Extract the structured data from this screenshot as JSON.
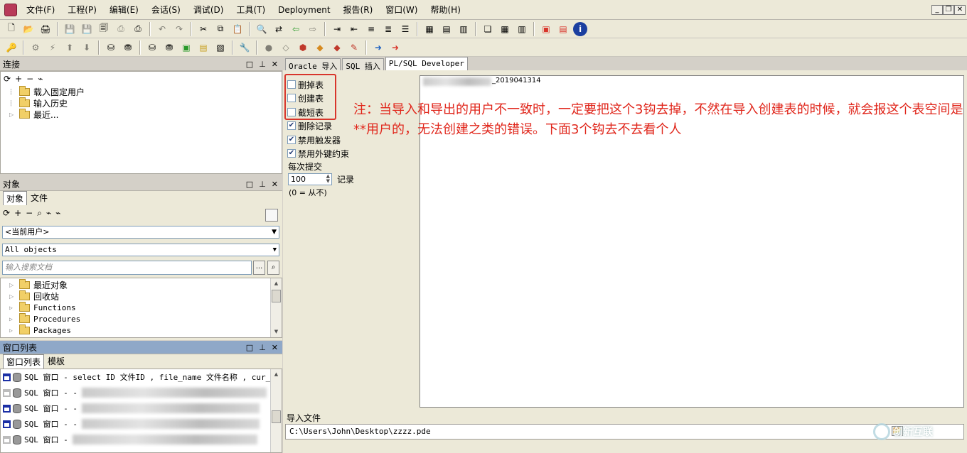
{
  "menubar": {
    "items": [
      "文件(F)",
      "工程(P)",
      "编辑(E)",
      "会话(S)",
      "调试(D)",
      "工具(T)",
      "Deployment",
      "报告(R)",
      "窗口(W)",
      "帮助(H)"
    ]
  },
  "panels": {
    "connection": {
      "title": "连接",
      "items": [
        "载入固定用户",
        "输入历史",
        "最近..."
      ]
    },
    "objects": {
      "title": "对象",
      "tabs": [
        "对象",
        "文件"
      ],
      "user_select": "<当前用户>",
      "type_select": "All objects",
      "search_placeholder": "输入搜索文档",
      "search_button": "...",
      "tree": [
        "最近对象",
        "回收站",
        "Functions",
        "Procedures",
        "Packages"
      ]
    },
    "window_list": {
      "title": "窗口列表",
      "tabs": [
        "窗口列表",
        "模板"
      ],
      "rows": [
        "SQL 窗口 - select ID 文件ID , file_name 文件名称 , cur_ti",
        "SQL 窗口 - -",
        "SQL 窗口 - -",
        "SQL 窗口 - -",
        "SQL 窗口 -"
      ]
    }
  },
  "main": {
    "tabs": [
      "Oracle 导入",
      "SQL 插入",
      "PL/SQL Developer"
    ],
    "options": [
      {
        "label": "删掉表",
        "checked": false
      },
      {
        "label": "创建表",
        "checked": false
      },
      {
        "label": "截短表",
        "checked": false
      },
      {
        "label": "删除记录",
        "checked": true
      },
      {
        "label": "禁用触发器",
        "checked": true
      },
      {
        "label": "禁用外键约束",
        "checked": true
      }
    ],
    "commit_label": "每次提交",
    "commit_value": "100",
    "commit_unit": "记录",
    "commit_hint": "(0 = 从不)",
    "log_text": "_2019041314",
    "annotation": "注：当导入和导出的用户不一致时，一定要把这个3钩去掉，不然在导入创建表的时候，就会报这个表空间是**用户的，无法创建之类的错误。下面3个钩去不去看个人",
    "import_file_label": "导入文件",
    "import_file_path": "C:\\Users\\John\\Desktop\\zzzz.pde",
    "watermark": "创新互联"
  },
  "colors": {
    "annotation_red": "#e0261b",
    "active_panel_header": "#8fa8c8"
  }
}
